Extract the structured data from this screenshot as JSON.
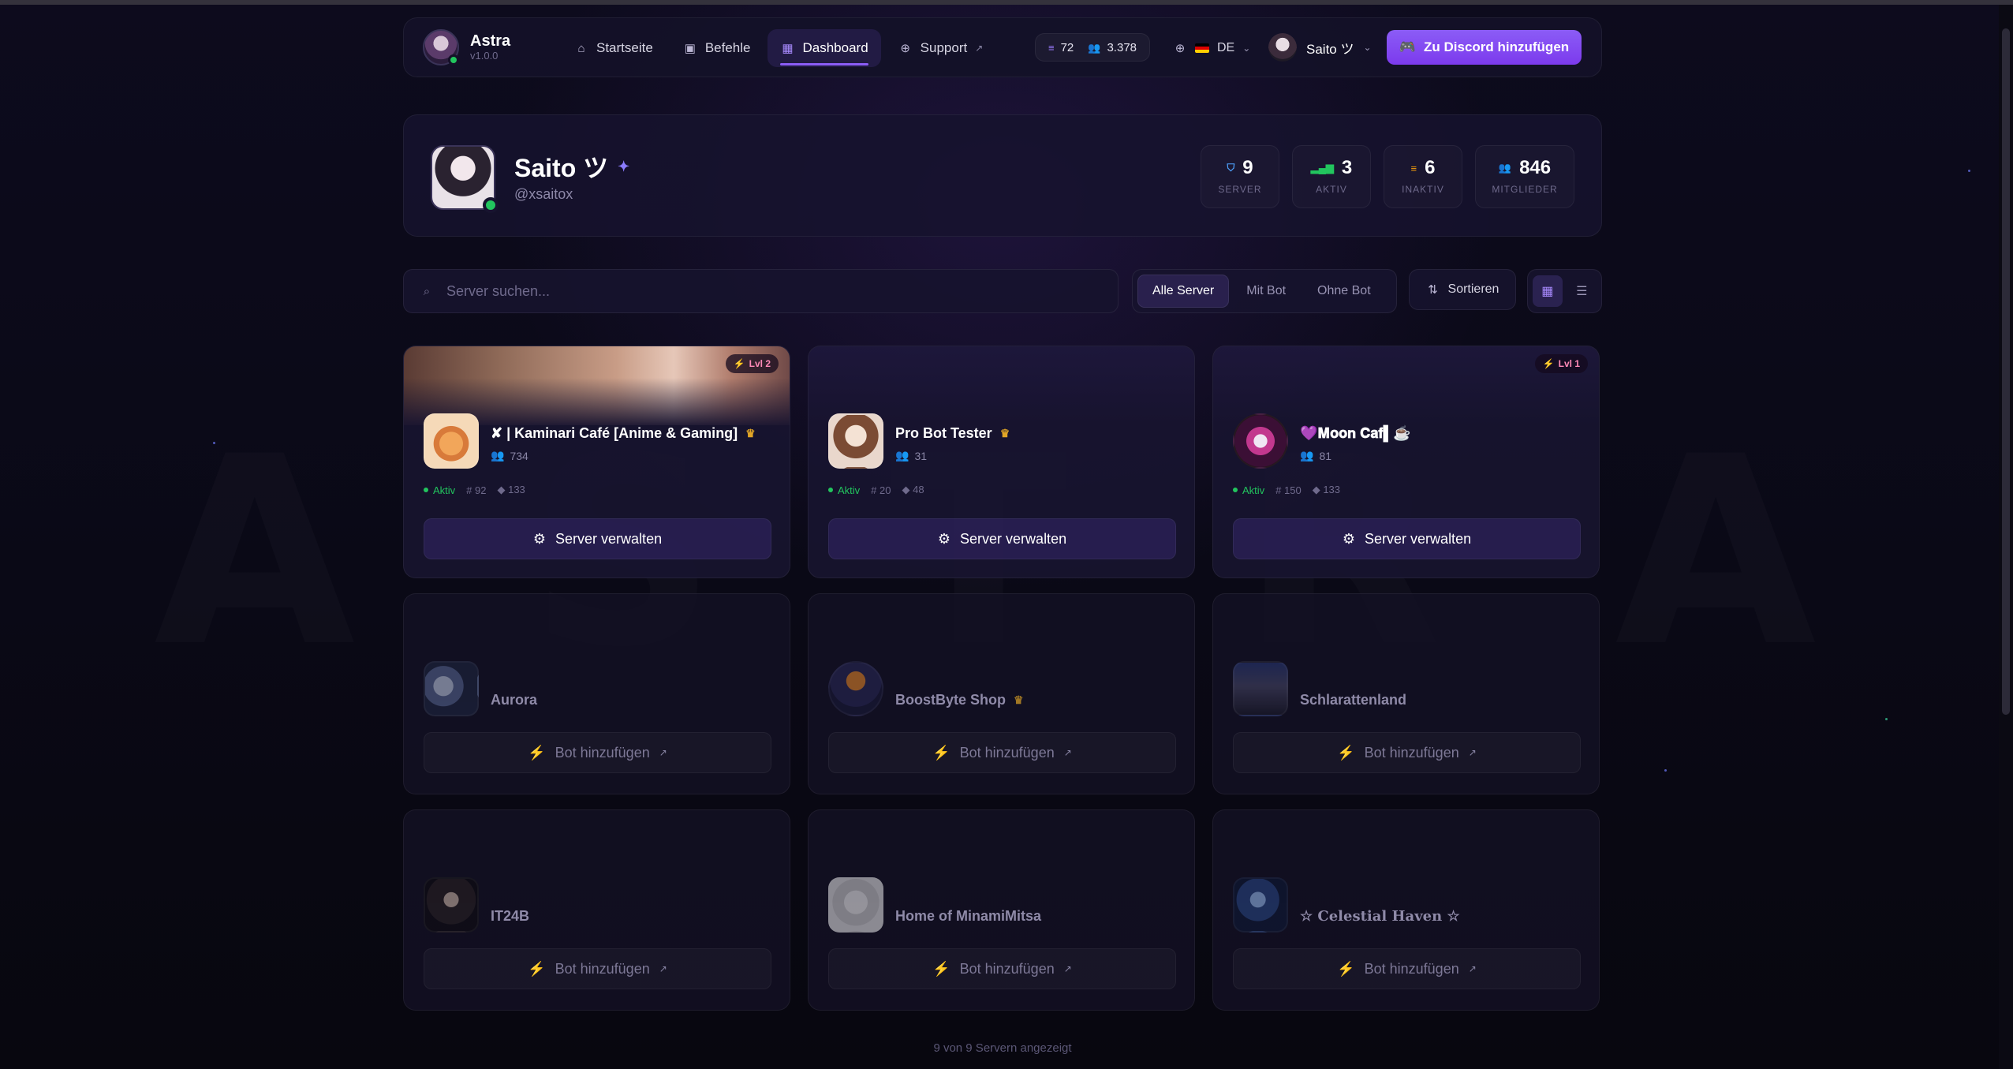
{
  "brand": {
    "name": "Astra",
    "version": "v1.0.0"
  },
  "nav": {
    "links": [
      {
        "label": "Startseite",
        "icon": "home-icon"
      },
      {
        "label": "Befehle",
        "icon": "terminal-icon"
      },
      {
        "label": "Dashboard",
        "icon": "grid-icon"
      },
      {
        "label": "Support",
        "icon": "globe-icon"
      }
    ],
    "active": "Dashboard",
    "stats": {
      "servers": "72",
      "users": "3.378"
    },
    "language": "DE",
    "user": "Saito ツ",
    "discord_button": "Zu Discord hinzufügen"
  },
  "profile": {
    "name": "Saito ツ",
    "handle": "@xsaitox",
    "stats": [
      {
        "value": "9",
        "label": "SERVER"
      },
      {
        "value": "3",
        "label": "AKTIV"
      },
      {
        "value": "6",
        "label": "INAKTIV"
      },
      {
        "value": "846",
        "label": "MITGLIEDER"
      }
    ]
  },
  "search": {
    "placeholder": "Server suchen..."
  },
  "filters": {
    "all": "Alle Server",
    "with_bot": "Mit Bot",
    "without_bot": "Ohne Bot",
    "active": "Alle Server"
  },
  "sort": {
    "label": "Sortieren"
  },
  "bot_servers": [
    {
      "name": "✘ | Kaminari Café [Anime & Gaming]",
      "members": "734",
      "status": "Aktiv",
      "channels": "92",
      "roles": "133",
      "level": "Lvl 2",
      "owner": true
    },
    {
      "name": "Pro Bot Tester",
      "members": "31",
      "status": "Aktiv",
      "channels": "20",
      "roles": "48",
      "level": "",
      "owner": true
    },
    {
      "name": "💜𝐌𝐨𝐨𝐧 𝐂𝐚𝐟▌☕",
      "members": "81",
      "status": "Aktiv",
      "channels": "150",
      "roles": "133",
      "level": "Lvl 1",
      "owner": false
    }
  ],
  "manage_label": "Server verwalten",
  "other_servers": [
    {
      "name": "Aurora",
      "owner": false
    },
    {
      "name": "BoostByte Shop",
      "owner": true
    },
    {
      "name": "Schlarattenland",
      "owner": false
    },
    {
      "name": "IT24B",
      "owner": false
    },
    {
      "name": "Home of MinamiMitsa",
      "owner": false
    },
    {
      "name": "☆ 𝐂𝐞𝐥𝐞𝐬𝐭𝐢𝐚𝐥 𝐇𝐚𝐯𝐞𝐧 ☆",
      "owner": false
    }
  ],
  "add_bot_label": "Bot hinzufügen",
  "footer": "9 von 9 Servern angezeigt",
  "colors": {
    "accent": "#8b5cf6",
    "online": "#22c55e",
    "crown": "#e0a526",
    "level": "#ff8ab8"
  }
}
